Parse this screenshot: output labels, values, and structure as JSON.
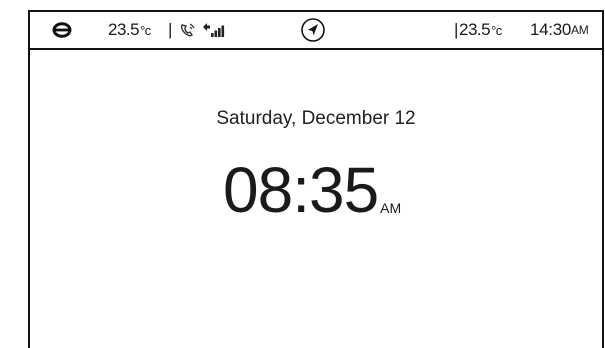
{
  "status_bar": {
    "logo_icon": "logo-icon",
    "left_temperature": "23.5",
    "left_temperature_unit": "°c",
    "separator": "|",
    "phone_icon": "phone-icon",
    "signal_icon": "signal-strength-icon",
    "nav_icon": "navigation-arrow-icon",
    "right_temperature": "23.5",
    "right_temperature_unit": "°c",
    "clock": "14:30",
    "clock_meridiem": "AM"
  },
  "main": {
    "date": "Saturday, December 12",
    "time": "08:35",
    "meridiem": "AM"
  }
}
